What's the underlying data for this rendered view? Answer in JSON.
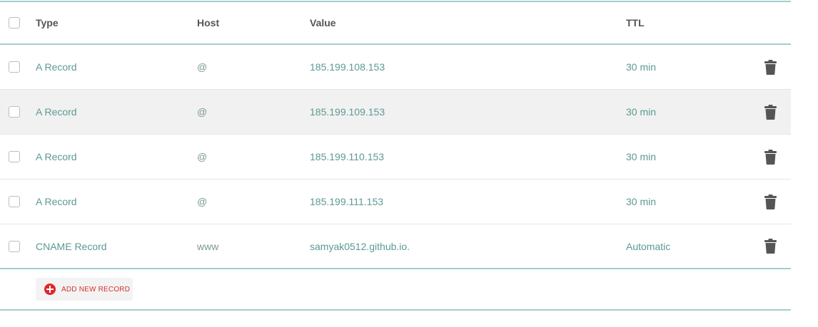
{
  "columns": {
    "type": "Type",
    "host": "Host",
    "value": "Value",
    "ttl": "TTL"
  },
  "records": [
    {
      "type": "A Record",
      "host": "@",
      "value": "185.199.108.153",
      "ttl": "30 min"
    },
    {
      "type": "A Record",
      "host": "@",
      "value": "185.199.109.153",
      "ttl": "30 min"
    },
    {
      "type": "A Record",
      "host": "@",
      "value": "185.199.110.153",
      "ttl": "30 min"
    },
    {
      "type": "A Record",
      "host": "@",
      "value": "185.199.111.153",
      "ttl": "30 min"
    },
    {
      "type": "CNAME Record",
      "host": "www",
      "value": "samyak0512.github.io.",
      "ttl": "Automatic"
    }
  ],
  "highlighted_row": 1,
  "add_button": {
    "label": "ADD NEW RECORD",
    "icon": "plus-circle-icon"
  },
  "icons": {
    "delete": "trash-icon"
  },
  "colors": {
    "accent_line": "#9fcfcb",
    "link_text": "#5b9a93",
    "add_red": "#e2262b"
  }
}
